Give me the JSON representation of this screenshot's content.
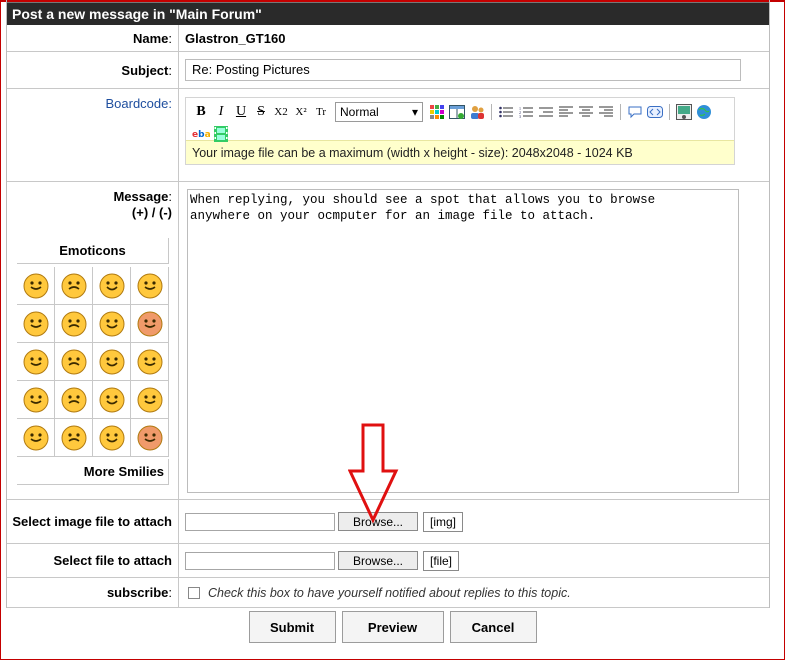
{
  "header": {
    "title": "Post a new message in \"Main Forum\""
  },
  "name_row": {
    "label": "Name",
    "value": "Glastron_GT160"
  },
  "subject_row": {
    "label": "Subject",
    "value": "Re: Posting Pictures"
  },
  "boardcode": {
    "label": "Boardcode",
    "font_size_select": "Normal",
    "tools": [
      "B",
      "I",
      "U",
      "S",
      "X2",
      "X²",
      "Tr"
    ],
    "notice": "Your image file can be a maximum (width x height - size): 2048x2048 - 1024 KB"
  },
  "message": {
    "label": "Message",
    "toggle": "(+) / (-)",
    "text": "When replying, you should see a spot that allows you to browse\nanywhere on your ocmputer for an image file to attach."
  },
  "emoticons": {
    "title": "Emoticons",
    "more_label": "More Smilies",
    "count": 20
  },
  "image_attach": {
    "label": "Select image file to attach",
    "browse": "Browse...",
    "tag": "[img]"
  },
  "file_attach": {
    "label": "Select file to attach",
    "browse": "Browse...",
    "tag": "[file]"
  },
  "subscribe": {
    "label": "subscribe",
    "text": "Check this box to have yourself notified about replies to this topic."
  },
  "buttons": {
    "submit": "Submit",
    "preview": "Preview",
    "cancel": "Cancel"
  },
  "colors": {
    "accent_red": "#c40000",
    "header_bg": "#2a2a2a",
    "notice_bg": "#ffffcc"
  }
}
